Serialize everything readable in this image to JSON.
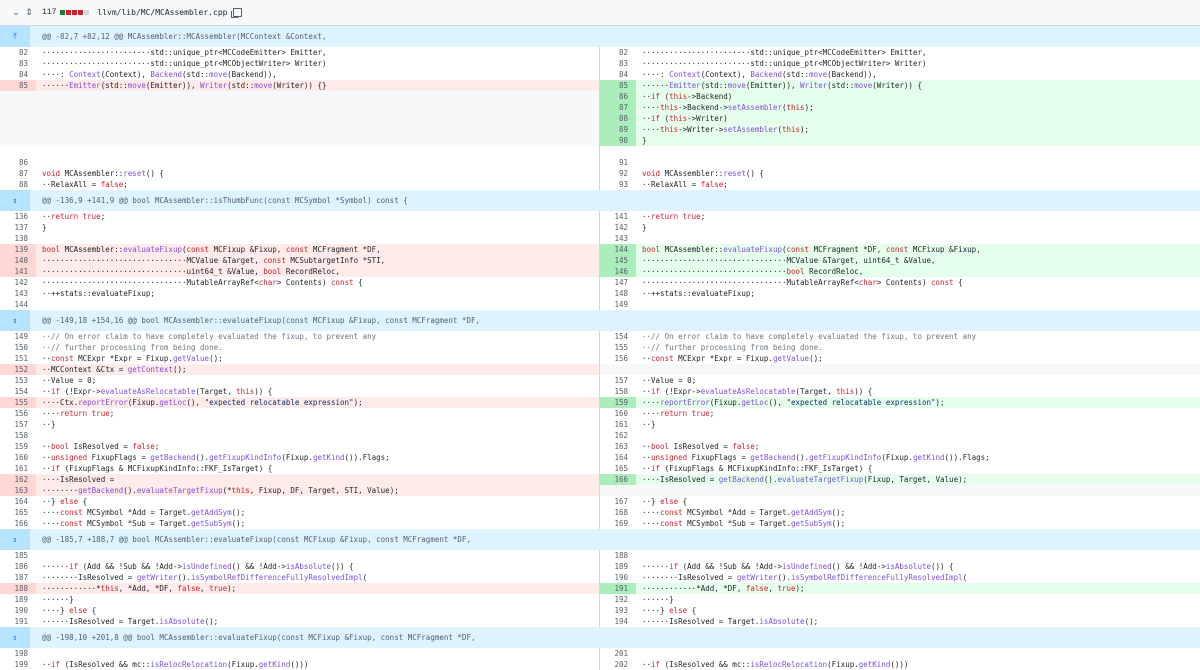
{
  "file_header": {
    "lines_changed": "117",
    "path": "llvm/lib/MC/MCAssembler.cpp",
    "stat_colors": [
      "#1a7f37",
      "#cf222e",
      "#cf222e",
      "#cf222e",
      "#d0d7de"
    ]
  },
  "colors": {
    "del_bg": "#ffebe9",
    "add_bg": "#e6ffec",
    "hunk_bg": "#ddf4ff"
  },
  "rows": [
    {
      "t": "hunk",
      "text": "@@ -82,7 +82,12 @@ MCAssembler::MCAssembler(MCContext &Context,",
      "icon": "up"
    },
    {
      "l": [
        "82",
        "························std::unique_ptr<MCCodeEmitter> Emitter,"
      ],
      "r": [
        "82",
        "························std::unique_ptr<MCCodeEmitter> Emitter,"
      ]
    },
    {
      "l": [
        "83",
        "························std::unique_ptr<MCObjectWriter> Writer)"
      ],
      "r": [
        "83",
        "························std::unique_ptr<MCObjectWriter> Writer)"
      ]
    },
    {
      "l": [
        "84",
        "····: Context(Context), Backend(std::move(Backend)),"
      ],
      "r": [
        "84",
        "····: Context(Context), Backend(std::move(Backend)),"
      ]
    },
    {
      "l": [
        "85",
        "······Emitter(std::move(Emitter)), Writer(std::move(Writer)) {}"
      ],
      "ls": "del",
      "r": [
        "85",
        "······Emitter(std::move(Emitter)), Writer(std::move(Writer)) {"
      ],
      "rs": "add"
    },
    {
      "l": null,
      "r": [
        "86",
        "··if (this->Backend)"
      ],
      "rs": "add"
    },
    {
      "l": null,
      "r": [
        "87",
        "····this->Backend->setAssembler(this);"
      ],
      "rs": "add"
    },
    {
      "l": null,
      "r": [
        "88",
        "··if (this->Writer)"
      ],
      "rs": "add"
    },
    {
      "l": null,
      "r": [
        "89",
        "····this->Writer->setAssembler(this);"
      ],
      "rs": "add"
    },
    {
      "l": null,
      "r": [
        "90",
        "}"
      ],
      "rs": "add"
    },
    {
      "l": [
        "",
        ""
      ],
      "r": [
        "",
        ""
      ]
    },
    {
      "l": [
        "86",
        ""
      ],
      "r": [
        "91",
        ""
      ]
    },
    {
      "l": [
        "87",
        "void MCAssembler::reset() {"
      ],
      "r": [
        "92",
        "void MCAssembler::reset() {"
      ]
    },
    {
      "l": [
        "88",
        "··RelaxAll = false;"
      ],
      "r": [
        "93",
        "··RelaxAll = false;"
      ]
    },
    {
      "t": "hunk",
      "text": "@@ -136,9 +141,9 @@ bool MCAssembler::isThumbFunc(const MCSymbol *Symbol) const {",
      "icon": "both"
    },
    {
      "l": [
        "136",
        "··return true;"
      ],
      "r": [
        "141",
        "··return true;"
      ]
    },
    {
      "l": [
        "137",
        "}"
      ],
      "r": [
        "142",
        "}"
      ]
    },
    {
      "l": [
        "138",
        ""
      ],
      "r": [
        "143",
        ""
      ]
    },
    {
      "l": [
        "139",
        "bool MCAssembler::evaluateFixup(const MCFixup &Fixup, const MCFragment *DF,"
      ],
      "ls": "del",
      "r": [
        "144",
        "bool MCAssembler::evaluateFixup(const MCFragment *DF, const MCFixup &Fixup,"
      ],
      "rs": "add"
    },
    {
      "l": [
        "140",
        "································MCValue &Target, const MCSubtargetInfo *STI,"
      ],
      "ls": "del",
      "r": [
        "145",
        "································MCValue &Target, uint64_t &Value,"
      ],
      "rs": "add"
    },
    {
      "l": [
        "141",
        "································uint64_t &Value, bool RecordReloc,"
      ],
      "ls": "del",
      "r": [
        "146",
        "································bool RecordReloc,"
      ],
      "rs": "add"
    },
    {
      "l": [
        "142",
        "································MutableArrayRef<char> Contents) const {"
      ],
      "r": [
        "147",
        "································MutableArrayRef<char> Contents) const {"
      ]
    },
    {
      "l": [
        "143",
        "··++stats::evaluateFixup;"
      ],
      "r": [
        "148",
        "··++stats::evaluateFixup;"
      ]
    },
    {
      "l": [
        "144",
        ""
      ],
      "r": [
        "149",
        ""
      ]
    },
    {
      "t": "hunk",
      "text": "@@ -149,18 +154,16 @@ bool MCAssembler::evaluateFixup(const MCFixup &Fixup, const MCFragment *DF,",
      "icon": "both"
    },
    {
      "l": [
        "149",
        "··// On error claim to have completely evaluated the fixup, to prevent any"
      ],
      "r": [
        "154",
        "··// On error claim to have completely evaluated the fixup, to prevent any"
      ]
    },
    {
      "l": [
        "150",
        "··// further processing from being done."
      ],
      "r": [
        "155",
        "··// further processing from being done."
      ]
    },
    {
      "l": [
        "151",
        "··const MCExpr *Expr = Fixup.getValue();"
      ],
      "r": [
        "156",
        "··const MCExpr *Expr = Fixup.getValue();"
      ]
    },
    {
      "l": [
        "152",
        "··MCContext &Ctx = getContext();"
      ],
      "ls": "del",
      "r": null
    },
    {
      "l": [
        "153",
        "··Value = 0;"
      ],
      "r": [
        "157",
        "··Value = 0;"
      ]
    },
    {
      "l": [
        "154",
        "··if (!Expr->evaluateAsRelocatable(Target, this)) {"
      ],
      "r": [
        "158",
        "··if (!Expr->evaluateAsRelocatable(Target, this)) {"
      ]
    },
    {
      "l": [
        "155",
        "····Ctx.reportError(Fixup.getLoc(), \"expected relocatable expression\");"
      ],
      "ls": "del",
      "r": [
        "159",
        "····reportError(Fixup.getLoc(), \"expected relocatable expression\");"
      ],
      "rs": "add"
    },
    {
      "l": [
        "156",
        "····return true;"
      ],
      "r": [
        "160",
        "····return true;"
      ]
    },
    {
      "l": [
        "157",
        "··}"
      ],
      "r": [
        "161",
        "··}"
      ]
    },
    {
      "l": [
        "158",
        ""
      ],
      "r": [
        "162",
        ""
      ]
    },
    {
      "l": [
        "159",
        "··bool IsResolved = false;"
      ],
      "r": [
        "163",
        "··bool IsResolved = false;"
      ]
    },
    {
      "l": [
        "160",
        "··unsigned FixupFlags = getBackend().getFixupKindInfo(Fixup.getKind()).Flags;"
      ],
      "r": [
        "164",
        "··unsigned FixupFlags = getBackend().getFixupKindInfo(Fixup.getKind()).Flags;"
      ]
    },
    {
      "l": [
        "161",
        "··if (FixupFlags & MCFixupKindInfo::FKF_IsTarget) {"
      ],
      "r": [
        "165",
        "··if (FixupFlags & MCFixupKindInfo::FKF_IsTarget) {"
      ]
    },
    {
      "l": [
        "162",
        "····IsResolved ="
      ],
      "ls": "del",
      "r": [
        "166",
        "····IsResolved = getBackend().evaluateTargetFixup(Fixup, Target, Value);"
      ],
      "rs": "add"
    },
    {
      "l": [
        "163",
        "········getBackend().evaluateTargetFixup(*this, Fixup, DF, Target, STI, Value);"
      ],
      "ls": "del",
      "r": null
    },
    {
      "l": [
        "164",
        "··} else {"
      ],
      "r": [
        "167",
        "··} else {"
      ]
    },
    {
      "l": [
        "165",
        "····const MCSymbol *Add = Target.getAddSym();"
      ],
      "r": [
        "168",
        "····const MCSymbol *Add = Target.getAddSym();"
      ]
    },
    {
      "l": [
        "166",
        "····const MCSymbol *Sub = Target.getSubSym();"
      ],
      "r": [
        "169",
        "····const MCSymbol *Sub = Target.getSubSym();"
      ]
    },
    {
      "t": "hunk",
      "text": "@@ -185,7 +188,7 @@ bool MCAssembler::evaluateFixup(const MCFixup &Fixup, const MCFragment *DF,",
      "icon": "both"
    },
    {
      "l": [
        "185",
        ""
      ],
      "r": [
        "188",
        ""
      ]
    },
    {
      "l": [
        "186",
        "······if (Add && !Sub && !Add->isUndefined() && !Add->isAbsolute()) {"
      ],
      "r": [
        "189",
        "······if (Add && !Sub && !Add->isUndefined() && !Add->isAbsolute()) {"
      ]
    },
    {
      "l": [
        "187",
        "········IsResolved = getWriter().isSymbolRefDifferenceFullyResolvedImpl("
      ],
      "r": [
        "190",
        "········IsResolved = getWriter().isSymbolRefDifferenceFullyResolvedImpl("
      ]
    },
    {
      "l": [
        "188",
        "············*this, *Add, *DF, false, true);"
      ],
      "ls": "del",
      "r": [
        "191",
        "············*Add, *DF, false, true);"
      ],
      "rs": "add"
    },
    {
      "l": [
        "189",
        "······}"
      ],
      "r": [
        "192",
        "······}"
      ]
    },
    {
      "l": [
        "190",
        "····} else {"
      ],
      "r": [
        "193",
        "····} else {"
      ]
    },
    {
      "l": [
        "191",
        "······IsResolved = Target.isAbsolute();"
      ],
      "r": [
        "194",
        "······IsResolved = Target.isAbsolute();"
      ]
    },
    {
      "t": "hunk",
      "text": "@@ -198,10 +201,8 @@ bool MCAssembler::evaluateFixup(const MCFixup &Fixup, const MCFragment *DF,",
      "icon": "both"
    },
    {
      "l": [
        "198",
        ""
      ],
      "r": [
        "201",
        ""
      ]
    },
    {
      "l": [
        "199",
        "··if (IsResolved && mc::isRelocRelocation(Fixup.getKind()))"
      ],
      "r": [
        "202",
        "··if (IsResolved && mc::isRelocRelocation(Fixup.getKind()))"
      ]
    }
  ]
}
